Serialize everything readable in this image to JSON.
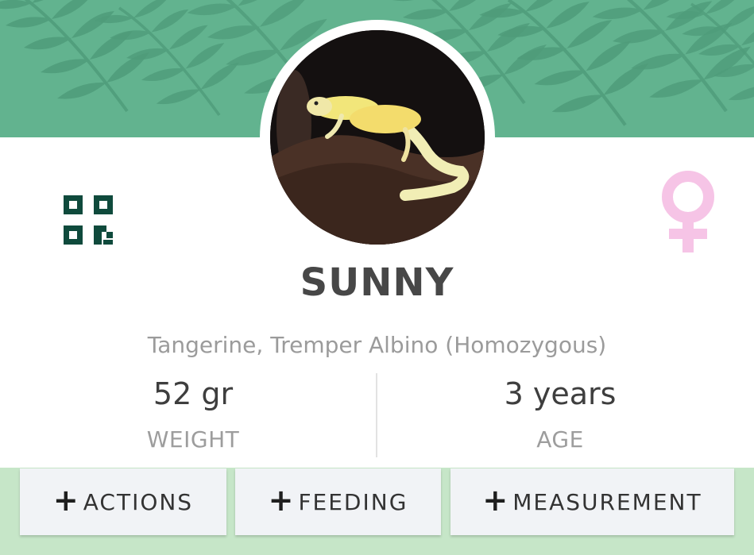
{
  "colors": {
    "banner": "#62b38f",
    "background": "#c6e6c8",
    "qr_icon": "#0f4a3c",
    "female_icon": "#f6c4e6"
  },
  "animal": {
    "name": "SUNNY",
    "morph": "Tangerine, Tremper Albino (Homozygous)",
    "sex_icon": "female-icon"
  },
  "stats": {
    "weight_value": "52 gr",
    "weight_label": "WEIGHT",
    "age_value": "3 years",
    "age_label": "AGE"
  },
  "actions": {
    "actions_label": "ACTIONS",
    "feeding_label": "FEEDING",
    "measurement_label": "MEASUREMENT",
    "plus_icon": "plus-icon"
  }
}
